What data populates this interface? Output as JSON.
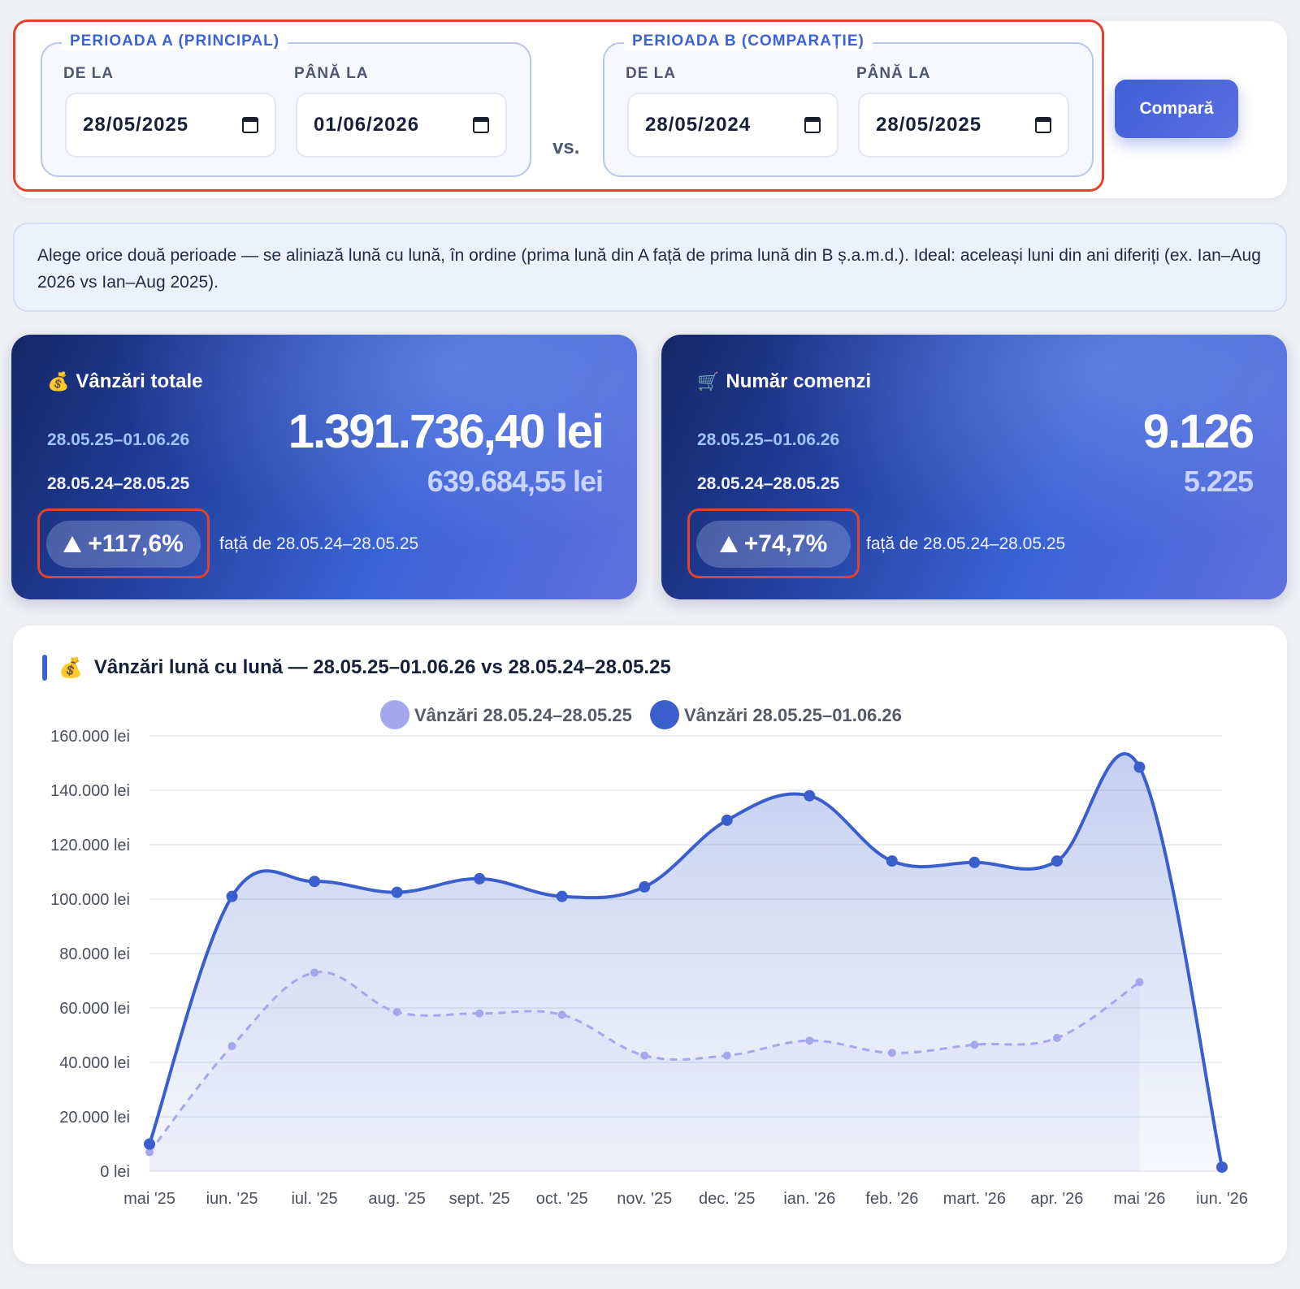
{
  "period_a": {
    "legend": "PERIOADA A (PRINCIPAL)",
    "from_label": "DE LA",
    "to_label": "PÂNĂ LA",
    "from_value": "28/05/2025",
    "to_value": "01/06/2026"
  },
  "vs_label": "vs.",
  "period_b": {
    "legend": "PERIOADA B (COMPARAȚIE)",
    "from_label": "DE LA",
    "to_label": "PÂNĂ LA",
    "from_value": "28/05/2024",
    "to_value": "28/05/2025"
  },
  "compare_button": "Compară",
  "info_note": "Alege orice două perioade — se aliniază lună cu lună, în ordine (prima lună din A față de prima lună din B ș.a.m.d.). Ideal: aceleași luni din ani diferiți (ex. Ian–Aug 2026 vs Ian–Aug 2025).",
  "kpi_sales": {
    "icon": "money-bag-icon",
    "icon_glyph": "💰",
    "title": "Vânzări totale",
    "range_a": "28.05.25–01.06.26",
    "range_b": "28.05.24–28.05.25",
    "value_a": "1.391.736,40 lei",
    "value_b": "639.684,55 lei",
    "change": "+117,6%",
    "compare_text": "față de 28.05.24–28.05.25"
  },
  "kpi_orders": {
    "icon": "cart-icon",
    "icon_glyph": "🛒",
    "title": "Număr comenzi",
    "range_a": "28.05.25–01.06.26",
    "range_b": "28.05.24–28.05.25",
    "value_a": "9.126",
    "value_b": "5.225",
    "change": "+74,7%",
    "compare_text": "față de 28.05.24–28.05.25"
  },
  "chart": {
    "icon_glyph": "💰",
    "title": "Vânzări lună cu lună — 28.05.25–01.06.26 vs 28.05.24–28.05.25"
  },
  "colors": {
    "accent": "#3b63d6",
    "series_a": "#3a5fcd",
    "series_b": "#a3a8ec",
    "highlight": "#e0442d"
  },
  "chart_data": {
    "type": "line",
    "categories": [
      "mai '25",
      "iun. '25",
      "iul. '25",
      "aug. '25",
      "sept. '25",
      "oct. '25",
      "nov. '25",
      "dec. '25",
      "ian. '26",
      "feb. '26",
      "mart. '26",
      "apr. '26",
      "mai '26",
      "iun. '26"
    ],
    "series": [
      {
        "name": "Vânzări 28.05.24–28.05.25",
        "style": "dashed",
        "color": "#a3a8ec",
        "values": [
          7000,
          46000,
          73000,
          58500,
          58000,
          57500,
          42500,
          42500,
          48000,
          43500,
          46500,
          49000,
          69500,
          null
        ]
      },
      {
        "name": "Vânzări 28.05.25–01.06.26",
        "style": "solid-filled",
        "color": "#3a5fcd",
        "values": [
          10000,
          101000,
          106500,
          102500,
          107500,
          101000,
          104500,
          129000,
          138000,
          114000,
          113500,
          114000,
          148500,
          1500
        ]
      }
    ],
    "y_ticks": [
      "0 lei",
      "20.000 lei",
      "40.000 lei",
      "60.000 lei",
      "80.000 lei",
      "100.000 lei",
      "120.000 lei",
      "140.000 lei",
      "160.000 lei"
    ],
    "ylim": [
      0,
      160000
    ],
    "grid": true,
    "legend_position": "top-center"
  }
}
